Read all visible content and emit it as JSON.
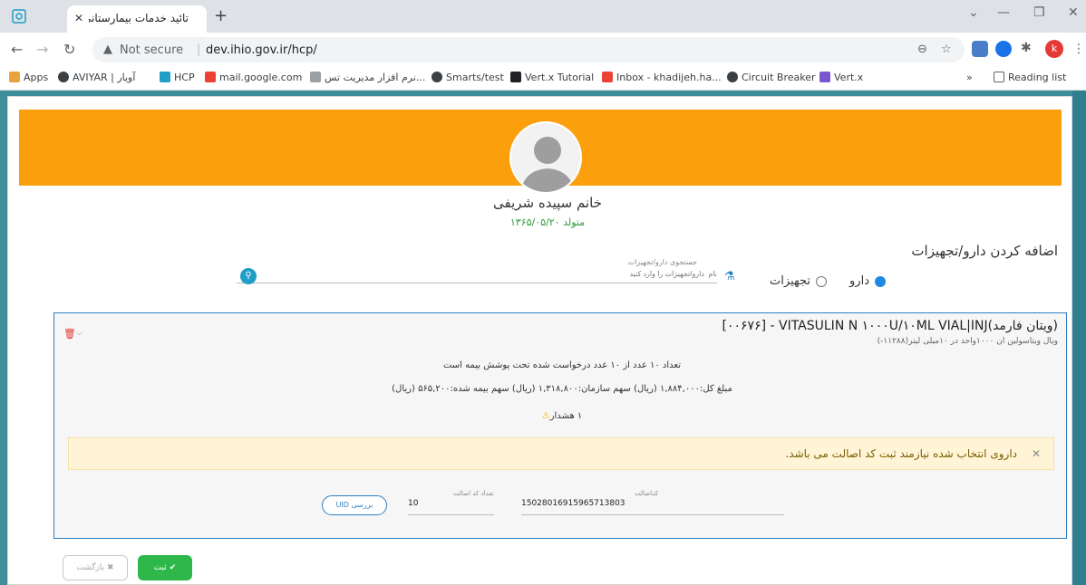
{
  "browser": {
    "tab_title": "تائید خدمات بیمارستانی",
    "not_secure": "Not secure",
    "url": "dev.ihio.gov.ir/hcp/",
    "reading_list": "Reading list",
    "profile_initial": "k",
    "bookmarks": [
      "Apps",
      "AVIYAR | آویار",
      "HCP",
      "mail.google.com",
      "نرم افزار مدیریت تس...",
      "Smarts/test",
      "Vert.x Tutorial",
      "Inbox - khadijeh.ha...",
      "Circuit Breaker",
      "Vert.x"
    ]
  },
  "patient": {
    "name": "خانم سپیده شریفی",
    "dob": "متولد ۱۳۶۵/۰۵/۲۰"
  },
  "add_section": {
    "title": "اضافه کردن دارو/تجهیزات",
    "radio_drug": "دارو",
    "radio_equipment": "تجهیزات",
    "search_label": "جستجوی دارو/تجهیزات",
    "search_placeholder": "نام  دارو/تجهیزات را وارد کنید"
  },
  "drug": {
    "title": "[۰۰۶۷۶] - VITASULIN N ۱۰۰۰U/۱۰ML VIAL|INJ(ویتان فارمد)",
    "subtitle": "ویال ویتاسولین ان ۱۰۰۰واحد در ۱۰میلی لیتر(۱۱۲۸۸-)",
    "coverage_text": "تعداد ۱۰ عدد از ۱۰ عدد درخواست شده تحت پوشش بیمه است",
    "price_text": "مبلغ کل:۱,۸۸۴,۰۰۰ (ریال) سهم سازمان:۱,۳۱۸,۸۰۰ (ریال) سهم بیمه شده:۵۶۵,۲۰۰ (ریال)",
    "warning_text": "۱ هشدار",
    "alert_text": "داروی انتخاب شده نیازمند ثبت کد اصالت می باشد.",
    "code_label": "کداصالت",
    "code_value": "15028016915965713803",
    "count_label": "تعداد کد اصالت",
    "count_value": "10",
    "uid_button": "بررسی UID"
  },
  "actions": {
    "submit": "ثبت",
    "cancel": "بازگشت"
  }
}
